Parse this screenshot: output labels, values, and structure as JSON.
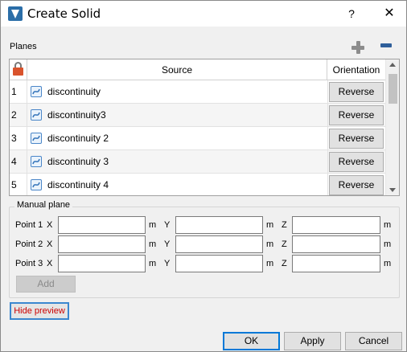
{
  "window": {
    "title": "Create Solid",
    "help_glyph": "?",
    "close_glyph": "✕"
  },
  "planes": {
    "label": "Planes",
    "add_icon": "plus-icon",
    "remove_icon": "minus-icon",
    "columns": {
      "lock_icon": "lock-icon",
      "source": "Source",
      "orientation": "Orientation"
    },
    "rows": [
      {
        "index": "1",
        "source": "discontinuity",
        "orientation": "Reverse"
      },
      {
        "index": "2",
        "source": "discontinuity3",
        "orientation": "Reverse"
      },
      {
        "index": "3",
        "source": "discontinuity 2",
        "orientation": "Reverse"
      },
      {
        "index": "4",
        "source": "discontinuity 3",
        "orientation": "Reverse"
      },
      {
        "index": "5",
        "source": "discontinuity 4",
        "orientation": "Reverse"
      }
    ]
  },
  "manual_plane": {
    "label": "Manual plane",
    "points": [
      {
        "label": "Point 1",
        "x": "",
        "y": "",
        "z": ""
      },
      {
        "label": "Point 2",
        "x": "",
        "y": "",
        "z": ""
      },
      {
        "label": "Point 3",
        "x": "",
        "y": "",
        "z": ""
      }
    ],
    "axis_x": "X",
    "axis_y": "Y",
    "axis_z": "Z",
    "unit": "m",
    "add_label": "Add"
  },
  "hide_preview_label": "Hide preview",
  "footer": {
    "ok": "OK",
    "apply": "Apply",
    "cancel": "Cancel"
  },
  "colors": {
    "accent": "#0078d7",
    "hide_preview_text": "#cc0000",
    "lock": "#d9532c"
  }
}
